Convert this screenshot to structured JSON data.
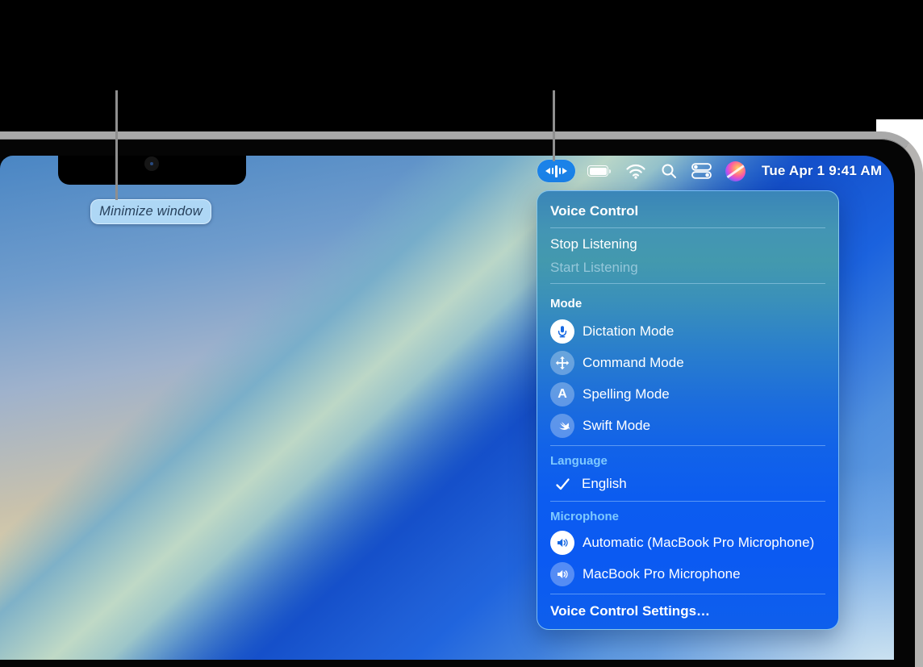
{
  "callouts": {
    "minimize_tooltip": "Minimize window"
  },
  "menu_bar": {
    "clock": "Tue Apr 1 9:41 AM",
    "icons": [
      "voice-control-icon",
      "battery-icon",
      "wifi-icon",
      "search-icon",
      "control-center-icon",
      "siri-icon"
    ]
  },
  "voice_control_menu": {
    "title": "Voice Control",
    "listening_items": [
      {
        "label": "Stop Listening",
        "enabled": true
      },
      {
        "label": "Start Listening",
        "enabled": false
      }
    ],
    "mode_section": {
      "header": "Mode",
      "items": [
        {
          "label": "Dictation Mode",
          "icon": "microphone-icon",
          "selected": true
        },
        {
          "label": "Command Mode",
          "icon": "move-arrows-icon",
          "selected": false
        },
        {
          "label": "Spelling Mode",
          "icon": "letter-a-icon",
          "selected": false
        },
        {
          "label": "Swift Mode",
          "icon": "swift-bird-icon",
          "selected": false
        }
      ]
    },
    "language_section": {
      "header": "Language",
      "items": [
        {
          "label": "English",
          "checked": true
        }
      ]
    },
    "microphone_section": {
      "header": "Microphone",
      "items": [
        {
          "label": "Automatic (MacBook Pro Microphone)",
          "icon": "speaker-icon",
          "selected": true
        },
        {
          "label": "MacBook Pro Microphone",
          "icon": "speaker-icon",
          "selected": false
        }
      ]
    },
    "settings_label": "Voice Control Settings…"
  },
  "colors": {
    "accent_blue": "#0b5af2",
    "menu_border": "#a0dcfa",
    "section_header_blue": "#7ec9ff",
    "tooltip_bg": "#aed7f5",
    "tooltip_text": "#27415c",
    "voice_control_pill": "#1b82e8",
    "callout_line": "#8f8f8f"
  }
}
